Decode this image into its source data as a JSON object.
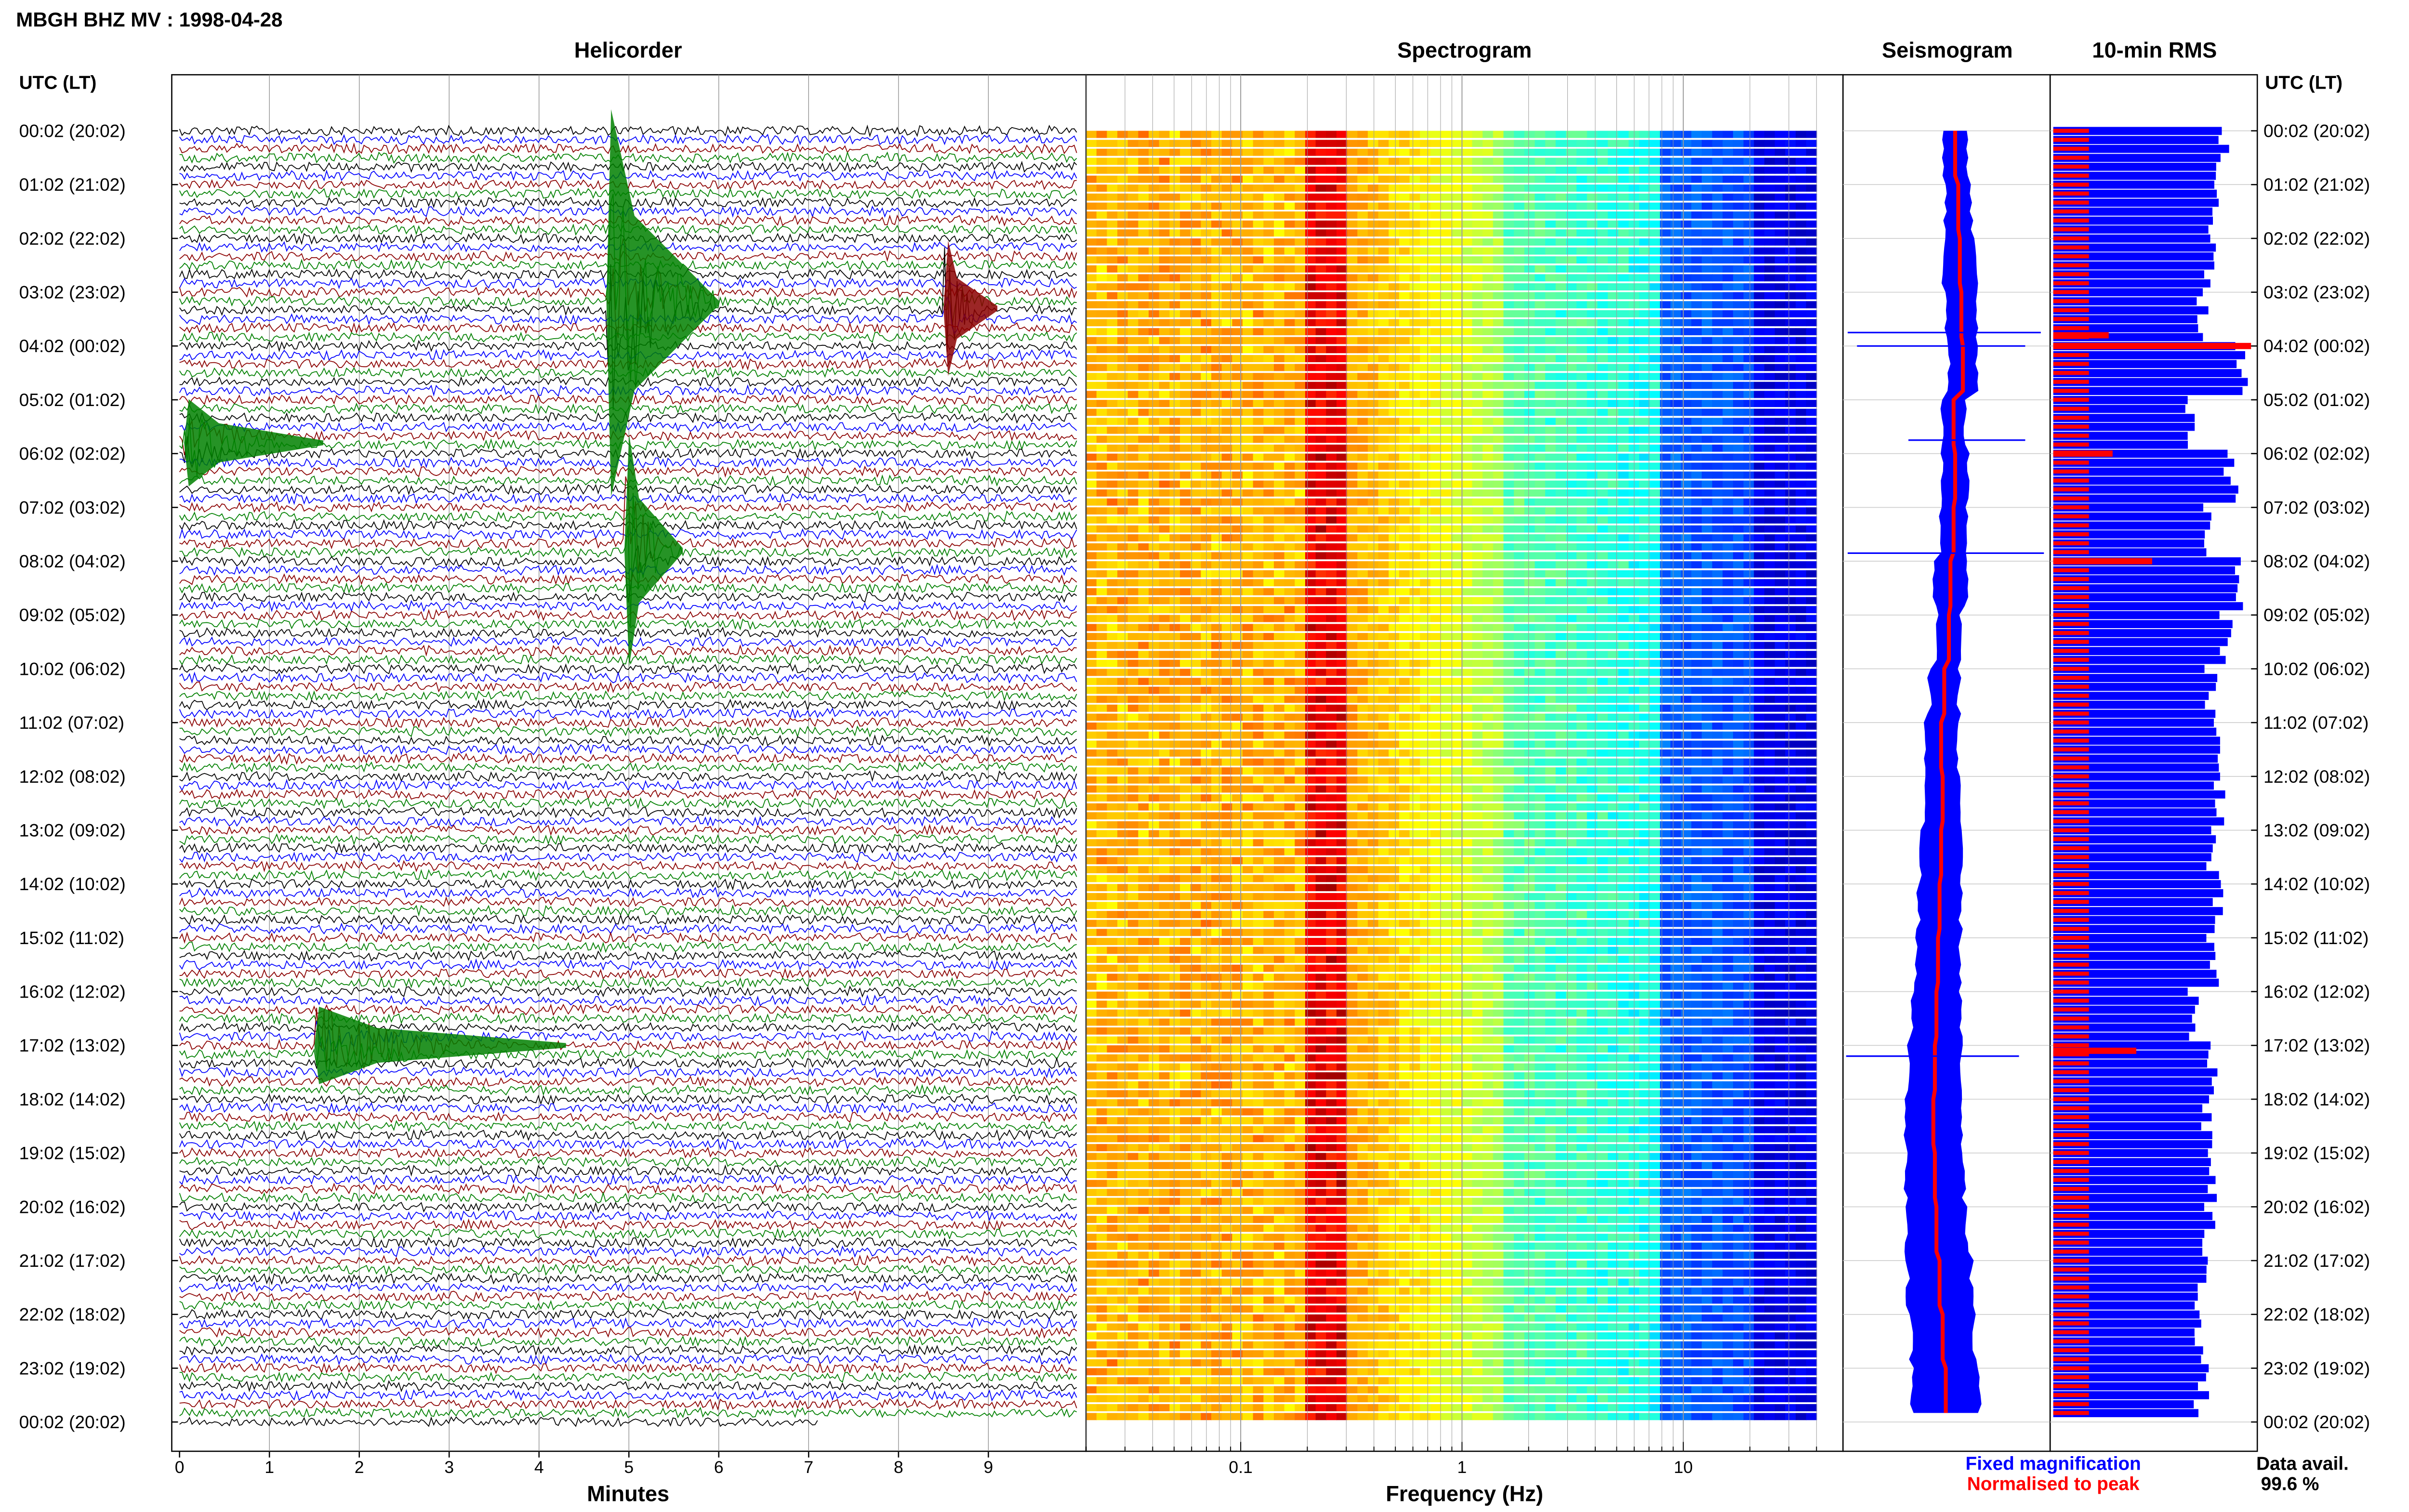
{
  "header": {
    "title": "MBGH BHZ MV : 1998-04-28",
    "time_axis_label": "UTC (LT)"
  },
  "panels": {
    "helicorder": "Helicorder",
    "spectrogram": "Spectrogram",
    "seismogram": "Seismogram",
    "rms": "10-min RMS"
  },
  "time_labels": [
    "00:02 (20:02)",
    "01:02 (21:02)",
    "02:02 (22:02)",
    "03:02 (23:02)",
    "04:02 (00:02)",
    "05:02 (01:02)",
    "06:02 (02:02)",
    "07:02 (03:02)",
    "08:02 (04:02)",
    "09:02 (05:02)",
    "10:02 (06:02)",
    "11:02 (07:02)",
    "12:02 (08:02)",
    "13:02 (09:02)",
    "14:02 (10:02)",
    "15:02 (11:02)",
    "16:02 (12:02)",
    "17:02 (13:02)",
    "18:02 (14:02)",
    "19:02 (15:02)",
    "20:02 (16:02)",
    "21:02 (17:02)",
    "22:02 (18:02)",
    "23:02 (19:02)",
    "00:02 (20:02)"
  ],
  "legend": {
    "fixed": "Fixed magnification",
    "normalised": "Normalised to peak",
    "fixed_color": "#0000ff",
    "normalised_color": "#ff0000"
  },
  "data_avail": {
    "label": "Data avail.",
    "value": "99.6 %"
  },
  "chart_data": [
    {
      "type": "line",
      "title": "Helicorder",
      "xlabel": "Minutes",
      "ylabel": "UTC (LT)",
      "x_ticks": [
        "0",
        "1",
        "2",
        "3",
        "4",
        "5",
        "6",
        "7",
        "8",
        "9"
      ],
      "xlim": [
        0,
        10
      ],
      "trace_colors": [
        "#000000",
        "#0000ff",
        "#8b0000",
        "#008000"
      ],
      "rows_per_hour": 6,
      "events": [
        {
          "hour": 3.2,
          "minute_start": 4.75,
          "minute_end": 6.0,
          "amplitude": 4.0,
          "color": "#008000"
        },
        {
          "hour": 3.3,
          "minute_start": 8.5,
          "minute_end": 9.1,
          "amplitude": 1.4,
          "color": "#8b0000"
        },
        {
          "hour": 5.8,
          "minute_start": 0.05,
          "minute_end": 1.6,
          "amplitude": 0.9,
          "color": "#008000"
        },
        {
          "hour": 7.8,
          "minute_start": 4.95,
          "minute_end": 5.6,
          "amplitude": 2.4,
          "color": "#008000"
        },
        {
          "hour": 17.0,
          "minute_start": 1.5,
          "minute_end": 4.3,
          "amplitude": 0.8,
          "color": "#008000"
        }
      ]
    },
    {
      "type": "heatmap",
      "title": "Spectrogram",
      "xlabel": "Frequency (Hz)",
      "x_scale": "log",
      "x_ticks": [
        "0.1",
        "1",
        "10"
      ],
      "xlim": [
        0.02,
        40
      ],
      "peak_band_hz": [
        0.2,
        0.3
      ]
    },
    {
      "type": "line",
      "title": "Seismogram",
      "series": [
        {
          "name": "Fixed magnification",
          "color": "#0000ff"
        },
        {
          "name": "Normalised to peak",
          "color": "#ff0000"
        }
      ],
      "hourly_envelope_halfwidth": [
        12,
        14,
        18,
        16,
        16,
        12,
        14,
        14,
        18,
        12,
        16,
        18,
        20,
        22,
        24,
        26,
        28,
        30,
        32,
        34,
        36,
        38,
        38,
        40
      ],
      "hourly_center_offset": [
        10,
        14,
        16,
        18,
        20,
        8,
        10,
        8,
        4,
        2,
        -4,
        -8,
        -6,
        -8,
        -10,
        -12,
        -14,
        -16,
        -18,
        -16,
        -14,
        -10,
        -6,
        -2
      ]
    },
    {
      "type": "bar",
      "title": "10-min RMS",
      "series": [
        {
          "name": "Fixed magnification",
          "color": "#0000ff"
        },
        {
          "name": "Normalised to peak",
          "color": "#ff0000"
        }
      ],
      "fixed_hourly_level": [
        0.85,
        0.8,
        0.8,
        0.75,
        0.95,
        0.7,
        0.9,
        0.78,
        0.92,
        0.88,
        0.8,
        0.82,
        0.85,
        0.8,
        0.82,
        0.8,
        0.7,
        0.8,
        0.78,
        0.8,
        0.78,
        0.75,
        0.75,
        0.75
      ],
      "normalised_level": 0.18,
      "normalised_spikes": [
        {
          "hour": 3.8,
          "value": 0.28
        },
        {
          "hour": 4.0,
          "value": 1.0
        },
        {
          "hour": 6.0,
          "value": 0.3
        },
        {
          "hour": 8.0,
          "value": 0.5
        },
        {
          "hour": 17.1,
          "value": 0.42
        }
      ]
    }
  ]
}
